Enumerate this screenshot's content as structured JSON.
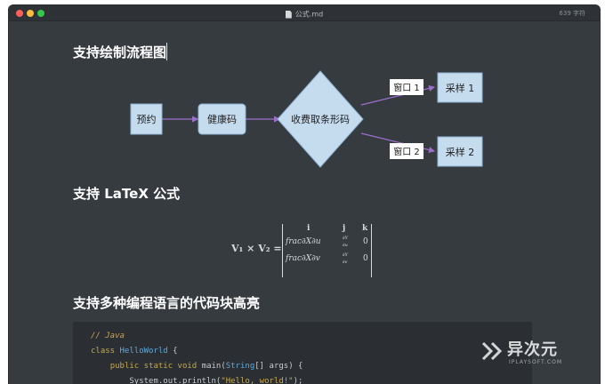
{
  "window": {
    "title": "公式.md",
    "word_count": "639 字符"
  },
  "headings": {
    "flowchart": "支持绘制流程图",
    "latex": "支持 LaTeX 公式",
    "code": "支持多种编程语言的代码块高亮"
  },
  "flowchart": {
    "node_reserve": "预约",
    "node_health_code": "健康码",
    "node_collect": "收费取条形码",
    "node_window1": "窗口 1",
    "node_window2": "窗口 2",
    "node_sample1": "采样 1",
    "node_sample2": "采样 2",
    "colors": {
      "node_fill": "#c5dcef",
      "node_stroke": "#8fb3d4",
      "arrow": "#9b6fc9",
      "label_fill": "#ffffff"
    }
  },
  "formula": {
    "lhs": "V₁ × V₂ =",
    "header_i": "i",
    "header_j": "j",
    "header_k": "k",
    "row1_col1": "frac∂X∂u",
    "row1_col2_num": "∂Y",
    "row1_col2_den": "∂u",
    "row1_col3": "0",
    "row2_col1": "frac∂X∂v",
    "row2_col2_num": "∂Y",
    "row2_col2_den": "∂v",
    "row2_col3": "0"
  },
  "code": {
    "line1": "// Java",
    "line2_kw": "class",
    "line2_name": "HelloWorld",
    "line2_rest": " {",
    "line3_indent": "    ",
    "line3_kw": "public static void",
    "line3_rest1": " main(",
    "line3_type": "String",
    "line3_rest2": "[] args) {",
    "line4_indent": "        ",
    "line4_plain": "System.out.println(",
    "line4_str": "\"Hello, world!\"",
    "line4_end": ");"
  },
  "watermark": {
    "cn": "异次元",
    "en": "IPLAYSOFT.COM"
  }
}
